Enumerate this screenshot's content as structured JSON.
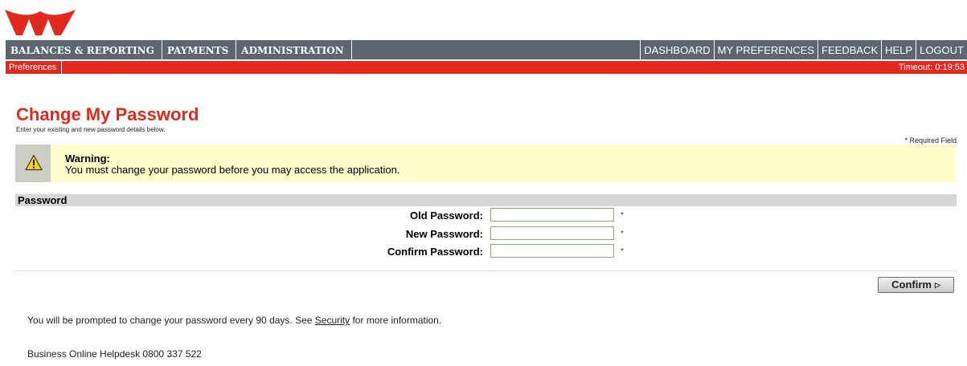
{
  "colors": {
    "accent": "#e0291f",
    "nav_bg": "#5d6670",
    "warning_bg": "#fdfdca"
  },
  "nav": {
    "left": [
      "BALANCES & REPORTING",
      "PAYMENTS",
      "ADMINISTRATION"
    ],
    "right": [
      "DASHBOARD",
      "MY PREFERENCES",
      "FEEDBACK",
      "HELP",
      "LOGOUT"
    ]
  },
  "subnav": {
    "current": "Preferences",
    "timeout": "Timeout: 0:19:53"
  },
  "page": {
    "title": "Change My Password",
    "subtitle": "Enter your existing and new password details below.",
    "required_note": "* Required Field"
  },
  "warning": {
    "icon": "warning-triangle-icon",
    "title": "Warning:",
    "text": "You must change your password before you may access the application."
  },
  "form": {
    "section_title": "Password",
    "fields": [
      {
        "label": "Old Password:",
        "value": "",
        "required_mark": "*"
      },
      {
        "label": "New Password:",
        "value": "",
        "required_mark": "*"
      },
      {
        "label": "Confirm Password:",
        "value": "",
        "required_mark": "*"
      }
    ],
    "confirm_label": "Confirm",
    "confirm_icon": "triangle-right-icon"
  },
  "footer": {
    "info_before": "You will be prompted to change your password every 90 days. See ",
    "info_link": "Security",
    "info_after": " for more information.",
    "helpdesk": "Business Online Helpdesk 0800 337 522"
  }
}
